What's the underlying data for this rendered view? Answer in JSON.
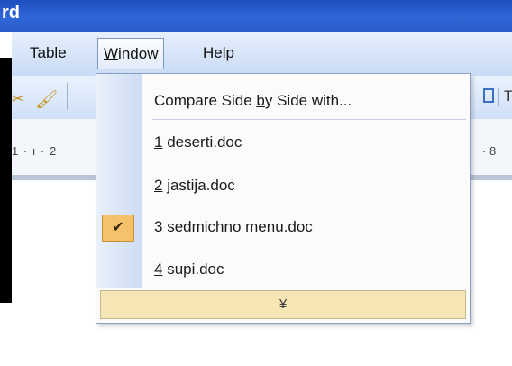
{
  "window": {
    "title_fragment": "rd"
  },
  "menu_bar": {
    "items": [
      {
        "label_pre": "T",
        "label_u": "a",
        "label_post": "ble"
      },
      {
        "label_pre": "",
        "label_u": "W",
        "label_post": "indow"
      },
      {
        "label_pre": "",
        "label_u": "H",
        "label_post": "elp"
      }
    ]
  },
  "toolbar": {
    "left_icons": [
      "cut-icon",
      "format-painter-icon"
    ],
    "right_icons": [
      "document-icon",
      "text-icon"
    ],
    "right_letter": "T"
  },
  "ruler": {
    "left_text": "1 · ı · 2",
    "right_text": "· 8"
  },
  "window_menu": {
    "compare": {
      "pre": "Compare Side ",
      "u": "b",
      "post": "y Side with..."
    },
    "documents": [
      {
        "num": "1",
        "name": " deserti.doc",
        "checked": false
      },
      {
        "num": "2",
        "name": " jastija.doc",
        "checked": false
      },
      {
        "num": "3",
        "name": " sedmichno menu.doc",
        "checked": true
      },
      {
        "num": "4",
        "name": " supi.doc",
        "checked": false
      }
    ],
    "check_icon": "checkmark-icon",
    "expand_icon": "double-chevron-down-icon",
    "expand_glyph": "¥"
  },
  "colors": {
    "title_bar": "#2f66d6",
    "menu_highlight_check": "#f3c26b",
    "expand_row": "#f6e6b6"
  }
}
